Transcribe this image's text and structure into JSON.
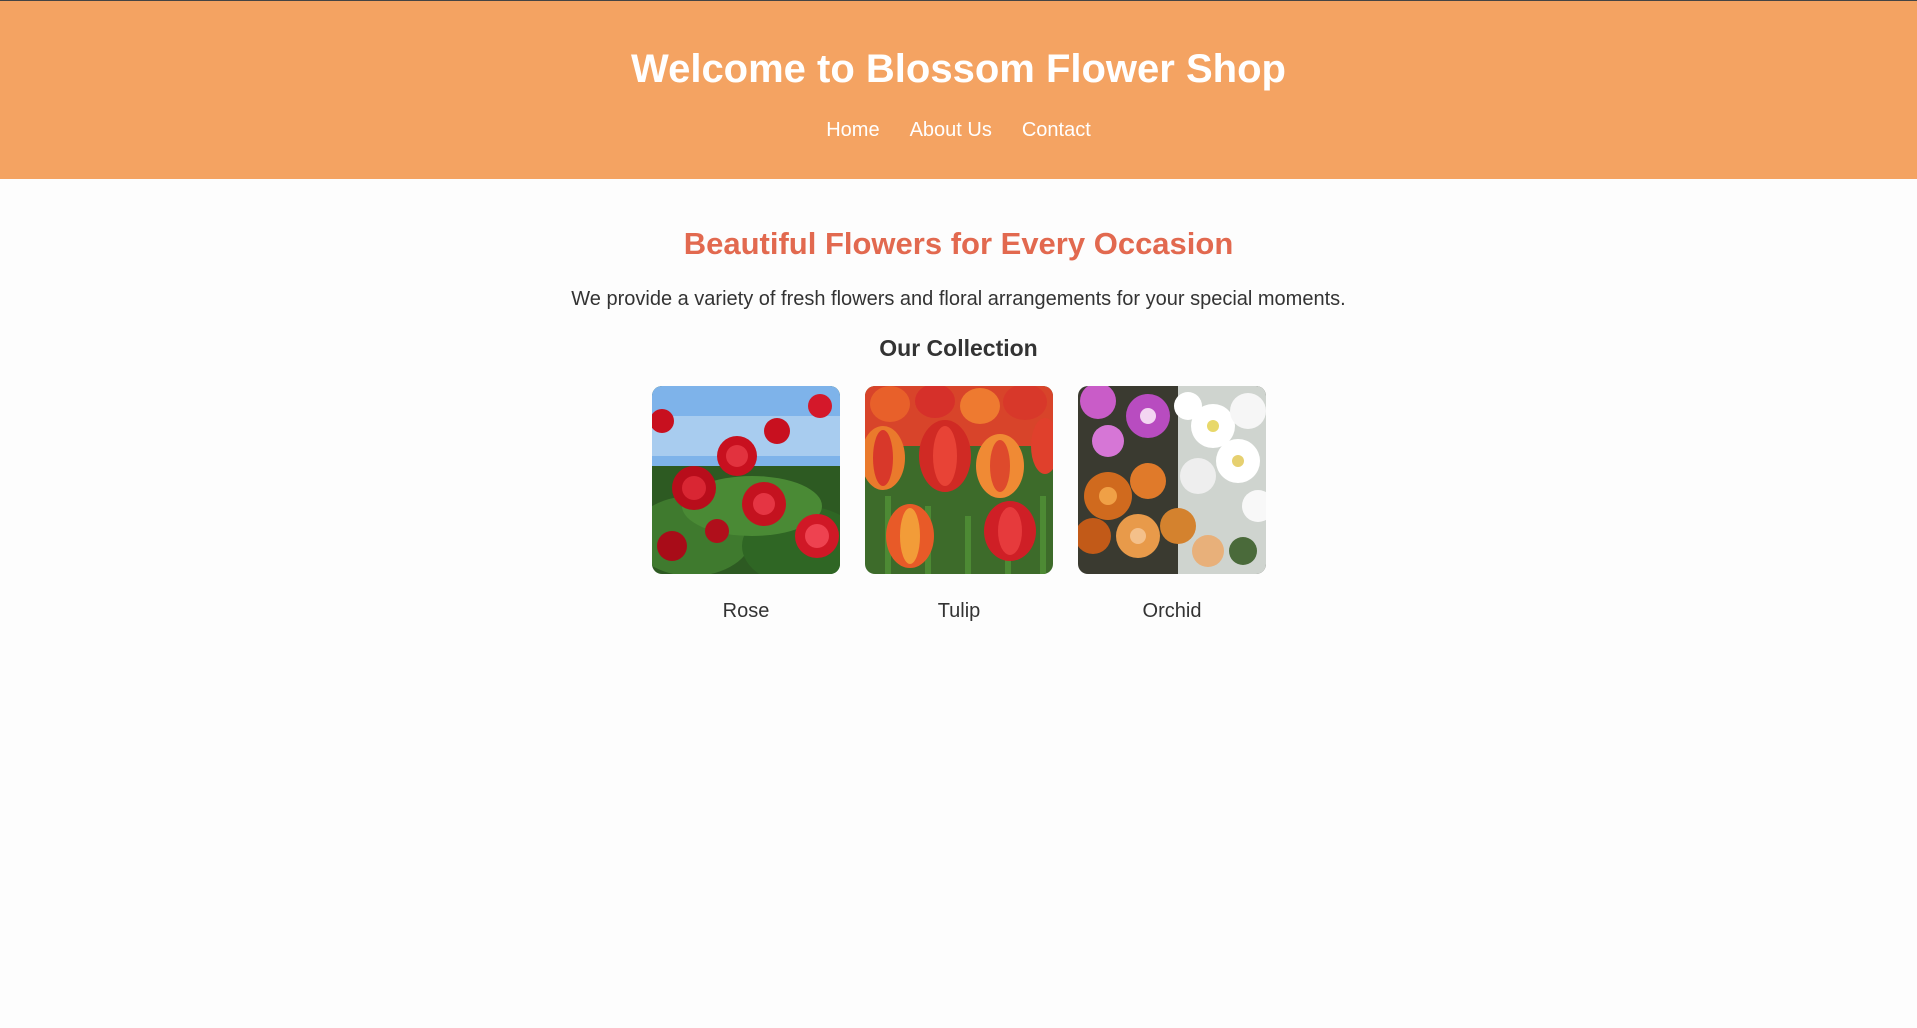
{
  "header": {
    "title": "Welcome to Blossom Flower Shop",
    "nav": [
      {
        "label": "Home"
      },
      {
        "label": "About Us"
      },
      {
        "label": "Contact"
      }
    ]
  },
  "main": {
    "headline": "Beautiful Flowers for Every Occasion",
    "intro": "We provide a variety of fresh flowers and floral arrangements for your special moments.",
    "collection_title": "Our Collection",
    "flowers": [
      {
        "name": "Rose"
      },
      {
        "name": "Tulip"
      },
      {
        "name": "Orchid"
      }
    ]
  },
  "colors": {
    "header_bg": "#f4a362",
    "accent": "#e2694f",
    "text": "#333333",
    "page_bg": "#fdfdfd"
  }
}
